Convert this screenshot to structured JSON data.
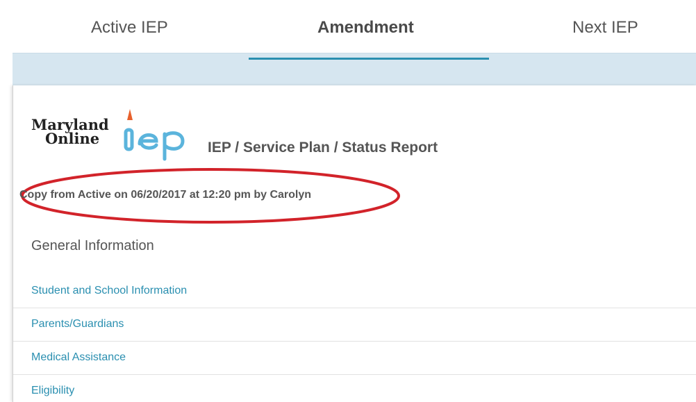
{
  "tabs": [
    {
      "label": "Active IEP",
      "active": false
    },
    {
      "label": "Amendment",
      "active": true
    },
    {
      "label": "Next IEP",
      "active": false
    }
  ],
  "logo": {
    "line1": "Maryland",
    "line2": "Online",
    "mark": "iep"
  },
  "report": {
    "title": "IEP / Service Plan / Status Report",
    "copy_info": "Copy from Active on 06/20/2017 at 12:20 pm by Carolyn"
  },
  "section": {
    "heading": "General Information",
    "items": [
      {
        "label": "Student and School Information"
      },
      {
        "label": "Parents/Guardians"
      },
      {
        "label": "Medical Assistance"
      },
      {
        "label": "Eligibility"
      }
    ]
  },
  "colors": {
    "accent": "#2a8fb0",
    "band": "#d6e6f0",
    "annotation": "#d2232a",
    "logo_flame": "#e8602c",
    "logo_iep": "#5bb4dc"
  }
}
